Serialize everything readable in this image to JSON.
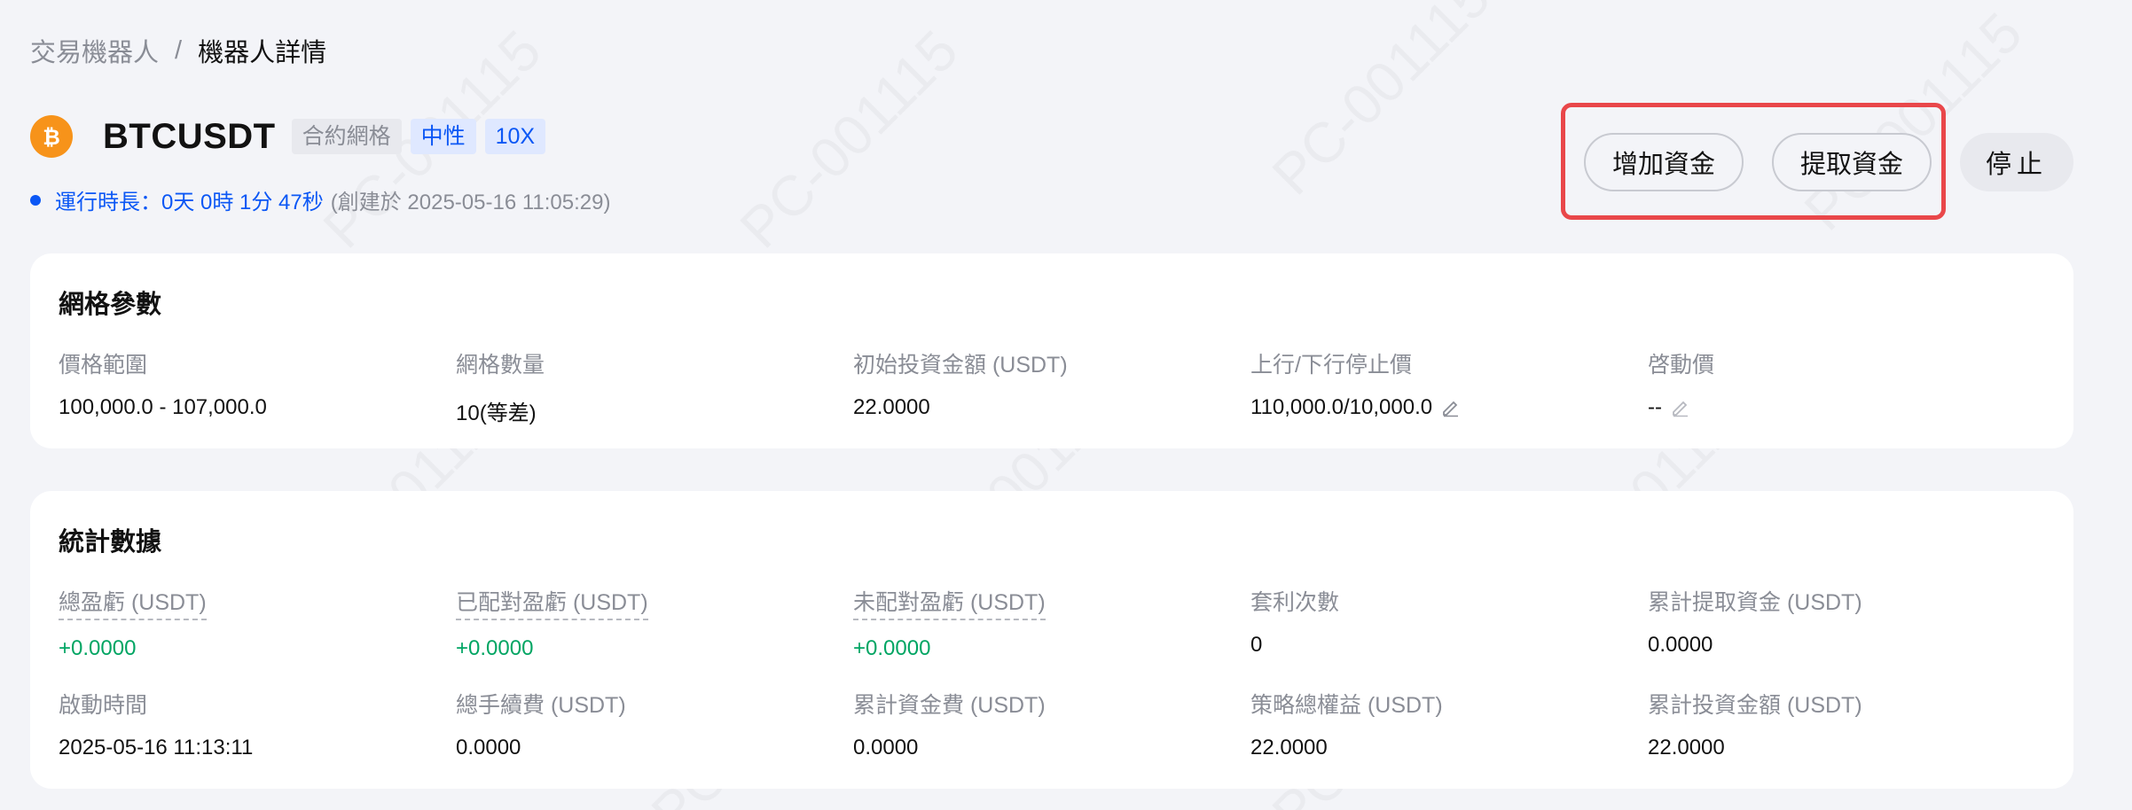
{
  "breadcrumb": {
    "root": "交易機器人",
    "separator": "/",
    "current": "機器人詳情"
  },
  "header": {
    "coin_icon": "bitcoin-icon",
    "symbol": "BTCUSDT",
    "tags": {
      "type": "合約網格",
      "direction": "中性",
      "leverage": "10X"
    }
  },
  "runtime": {
    "label": "運行時長：0天 0時 1分 47秒",
    "created": "(創建於 2025-05-16 11:05:29)"
  },
  "actions": {
    "add_funds": "增加資金",
    "withdraw_funds": "提取資金",
    "stop": "停止"
  },
  "grid_params": {
    "title": "網格參數",
    "fields": [
      {
        "label": "價格範圍",
        "value": "100,000.0 - 107,000.0"
      },
      {
        "label": "網格數量",
        "value": "10(等差)"
      },
      {
        "label": "初始投資金額 (USDT)",
        "value": "22.0000"
      },
      {
        "label": "上行/下行停止價",
        "value": "110,000.0/10,000.0"
      },
      {
        "label": "啓動價",
        "value": "--"
      }
    ]
  },
  "stats": {
    "title": "統計數據",
    "row1": [
      {
        "label": "總盈虧 (USDT)",
        "value": "+0.0000"
      },
      {
        "label": "已配對盈虧 (USDT)",
        "value": "+0.0000"
      },
      {
        "label": "未配對盈虧 (USDT)",
        "value": "+0.0000"
      },
      {
        "label": "套利次數",
        "value": "0"
      },
      {
        "label": "累計提取資金 (USDT)",
        "value": "0.0000"
      }
    ],
    "row2": [
      {
        "label": "啟動時間",
        "value": "2025-05-16 11:13:11"
      },
      {
        "label": "總手續費 (USDT)",
        "value": "0.0000"
      },
      {
        "label": "累計資金費 (USDT)",
        "value": "0.0000"
      },
      {
        "label": "策略總權益 (USDT)",
        "value": "22.0000"
      },
      {
        "label": "累計投資金額 (USDT)",
        "value": "22.0000"
      }
    ]
  },
  "watermark": "PC-001115",
  "colors": {
    "accent": "#0b57f5",
    "profit": "#00a563",
    "highlight": "#e9474a",
    "bitcoin": "#f7931a"
  }
}
